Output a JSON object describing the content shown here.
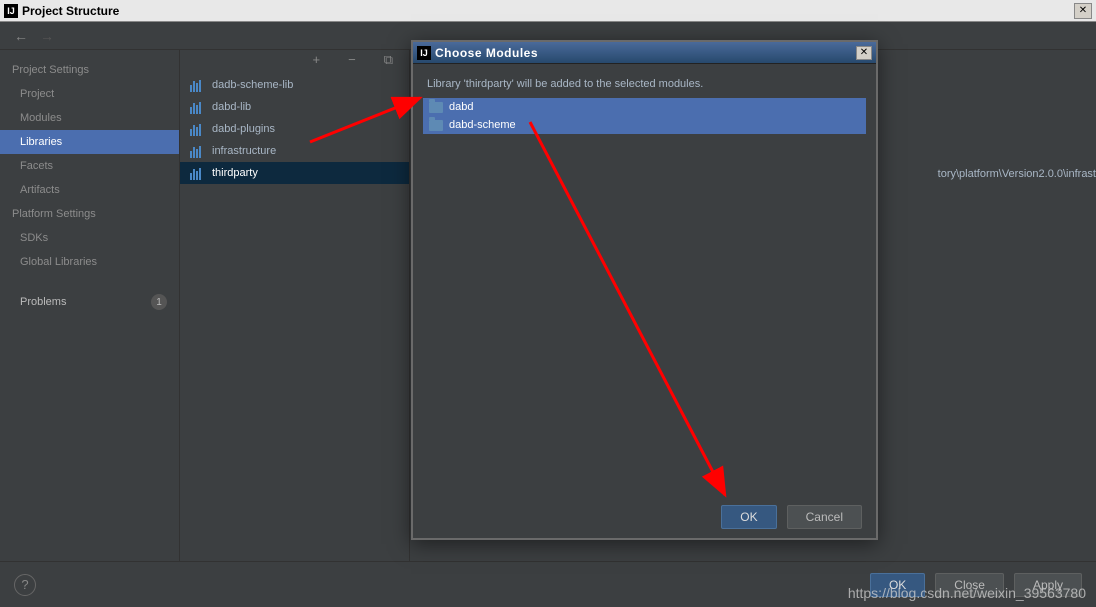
{
  "window": {
    "title": "Project Structure",
    "icon_label": "IJ"
  },
  "sidebar": {
    "heading_settings": "Project Settings",
    "items": [
      {
        "label": "Project"
      },
      {
        "label": "Modules"
      },
      {
        "label": "Libraries"
      },
      {
        "label": "Facets"
      },
      {
        "label": "Artifacts"
      }
    ],
    "heading_platform": "Platform Settings",
    "platform_items": [
      {
        "label": "SDKs"
      },
      {
        "label": "Global Libraries"
      }
    ],
    "problems_label": "Problems",
    "problems_count": "1"
  },
  "libraries": [
    {
      "name": "dadb-scheme-lib"
    },
    {
      "name": "dabd-lib"
    },
    {
      "name": "dabd-plugins"
    },
    {
      "name": "infrastructure"
    },
    {
      "name": "thirdparty"
    }
  ],
  "detail": {
    "path_fragment": "tory\\platform\\Version2.0.0\\infrast"
  },
  "modal": {
    "title": "Choose Modules",
    "message": "Library 'thirdparty' will be added to the selected modules.",
    "modules": [
      {
        "name": "dabd"
      },
      {
        "name": "dabd-scheme"
      }
    ],
    "ok": "OK",
    "cancel": "Cancel"
  },
  "footer": {
    "ok": "OK",
    "close": "Close",
    "apply": "Apply"
  },
  "watermark": "https://blog.csdn.net/weixin_39563780"
}
